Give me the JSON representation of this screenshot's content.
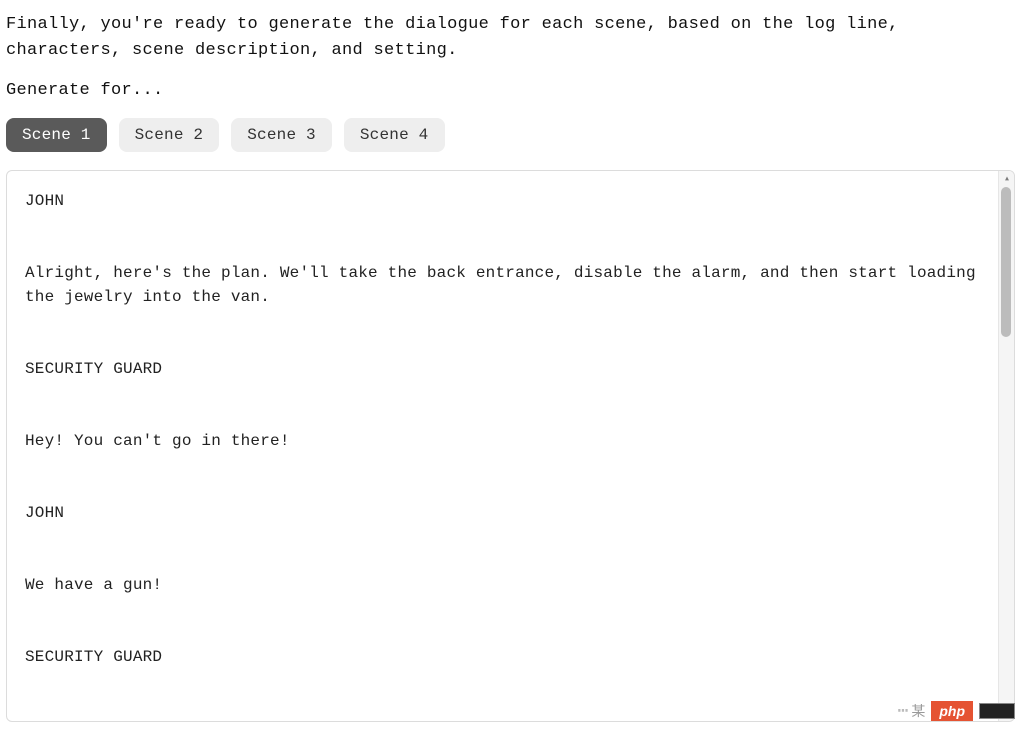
{
  "intro": "Finally, you're ready to generate the dialogue for each scene, based on the log line, characters, scene description, and setting.",
  "generate_label": "Generate for...",
  "tabs": [
    {
      "label": "Scene 1",
      "active": true
    },
    {
      "label": "Scene 2",
      "active": false
    },
    {
      "label": "Scene 3",
      "active": false
    },
    {
      "label": "Scene 4",
      "active": false
    }
  ],
  "dialogue": "JOHN\n\n\nAlright, here's the plan. We'll take the back entrance, disable the alarm, and then start loading the jewelry into the van.\n\n\nSECURITY GUARD\n\n\nHey! You can't go in there!\n\n\nJOHN\n\n\nWe have a gun!\n\n\nSECURITY GUARD\n\n\nDon't shoot! I'm unarmed!\n\n\nJOHN",
  "watermark": {
    "text": "某",
    "badge": "php"
  }
}
